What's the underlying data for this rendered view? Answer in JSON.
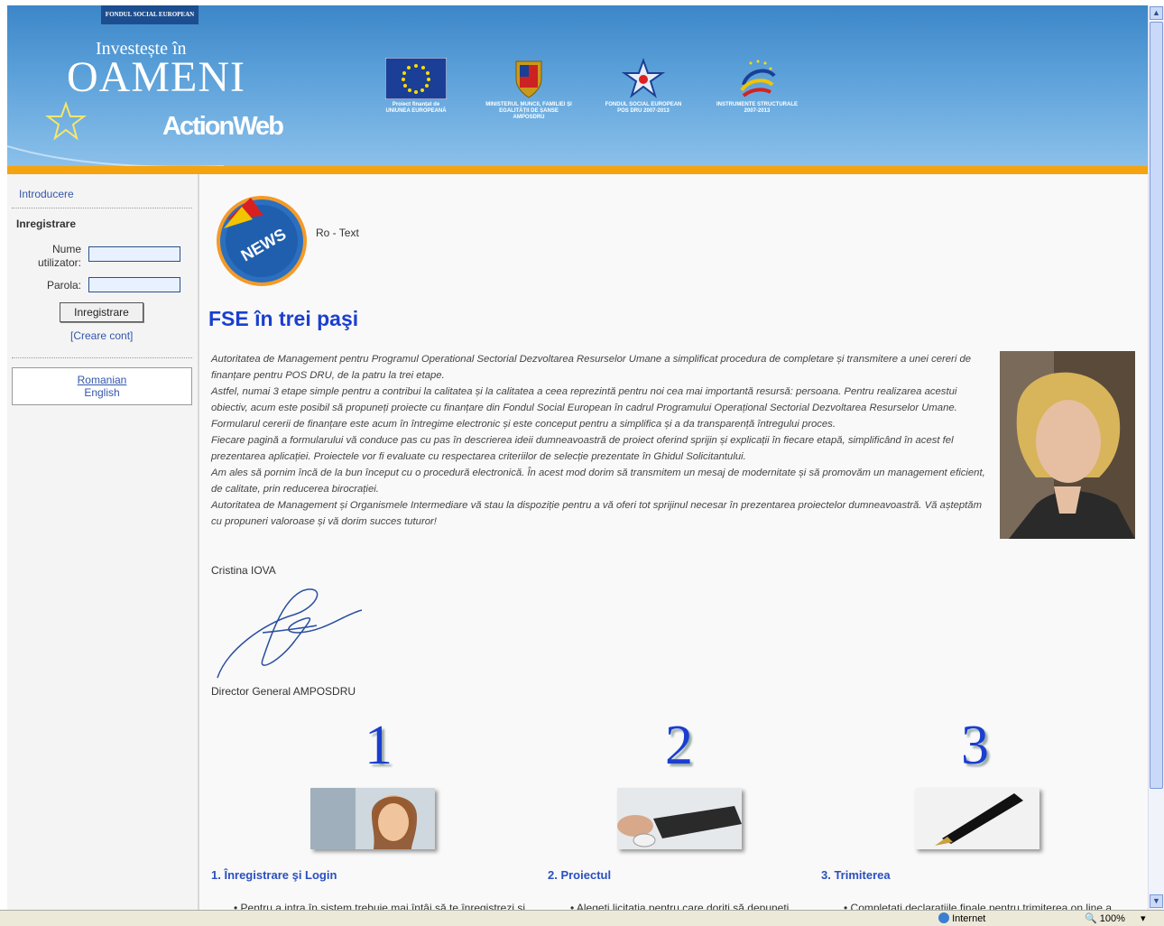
{
  "header": {
    "fse_tag": "FONDUL SOCIAL EUROPEAN",
    "tagline": "Investește în",
    "headline": "OAMENI",
    "brand": "ActionWeb",
    "logos": [
      {
        "icon": "eu-flag-icon",
        "caption": "Proiect finanțat de UNIUNEA EUROPEANĂ"
      },
      {
        "icon": "coat-of-arms-icon",
        "caption": "MINISTERUL MUNCII, FAMILIEI ȘI EGALITĂȚII DE ȘANSE AMPOSDRU"
      },
      {
        "icon": "fse-star-icon",
        "caption": "FONDUL SOCIAL EUROPEAN POS DRU 2007-2013"
      },
      {
        "icon": "structural-instruments-icon",
        "caption": "INSTRUMENTE STRUCTURALE 2007-2013"
      }
    ],
    "accent_color": "#f5a30f"
  },
  "sidebar": {
    "intro_link": "Introducere",
    "login": {
      "title": "Inregistrare",
      "username_label": "Nume utilizator:",
      "username_value": "",
      "password_label": "Parola:",
      "password_value": "",
      "submit_label": "Inregistrare",
      "create_account": "[Creare cont]"
    },
    "languages": [
      "Romanian",
      "English"
    ]
  },
  "main": {
    "news_badge": "NEWS",
    "news_label": "Ro - Text",
    "title": "FSE în trei paşi",
    "paragraphs": [
      "Autoritatea de Management pentru Programul Operational Sectorial Dezvoltarea Resurselor Umane a simplificat procedura de completare și transmitere a unei cereri de finanțare pentru POS DRU, de la patru la trei etape.",
      "Astfel, numai 3 etape simple pentru a contribui la calitatea și la calitatea a ceea reprezintă pentru noi cea mai importantă resursă: persoana. Pentru realizarea acestui obiectiv, acum este posibil să propuneți proiecte cu finanțare din Fondul Social European în cadrul Programului Operațional Sectorial Dezvoltarea Resurselor Umane.",
      "Formularul cererii de finanțare este acum în întregime electronic și este conceput pentru a simplifica și a da transparență întregului proces.",
      "Fiecare pagină a formularului vă conduce pas cu pas în descrierea ideii dumneavoastră de proiect oferind sprijin și explicații în fiecare etapă, simplificând în acest fel prezentarea aplicației. Proiectele vor fi evaluate cu respectarea criteriilor de selecție prezentate în Ghidul Solicitantului.",
      "Am ales să pornim încă de la bun început cu o procedură electronică. În acest mod dorim să transmitem un mesaj de modernitate și să promovăm un management eficient, de calitate, prin reducerea birocrației.",
      "Autoritatea de Management și Organismele Intermediare vă stau la dispoziție pentru a vă oferi tot sprijinul necesar în prezentarea proiectelor dumneavoastră. Vă așteptăm cu propuneri valoroase și vă dorim succes tuturor!"
    ],
    "signer_name": "Cristina IOVA",
    "signer_title": "Director General AMPOSDRU",
    "steps": [
      {
        "number": "1",
        "title": "1. Înregistrare şi Login",
        "bullet": "Pentru a intra în sistem trebuie mai întâi să te înregistrezi și"
      },
      {
        "number": "2",
        "title": "2. Proiectul",
        "bullet": "Alegeți licitația pentru care doriți să depuneți"
      },
      {
        "number": "3",
        "title": "3. Trimiterea",
        "bullet": "Completați declarațiile finale pentru trimiterea on line a"
      }
    ]
  },
  "statusbar": {
    "zone": "Internet",
    "zoom": "100%"
  }
}
